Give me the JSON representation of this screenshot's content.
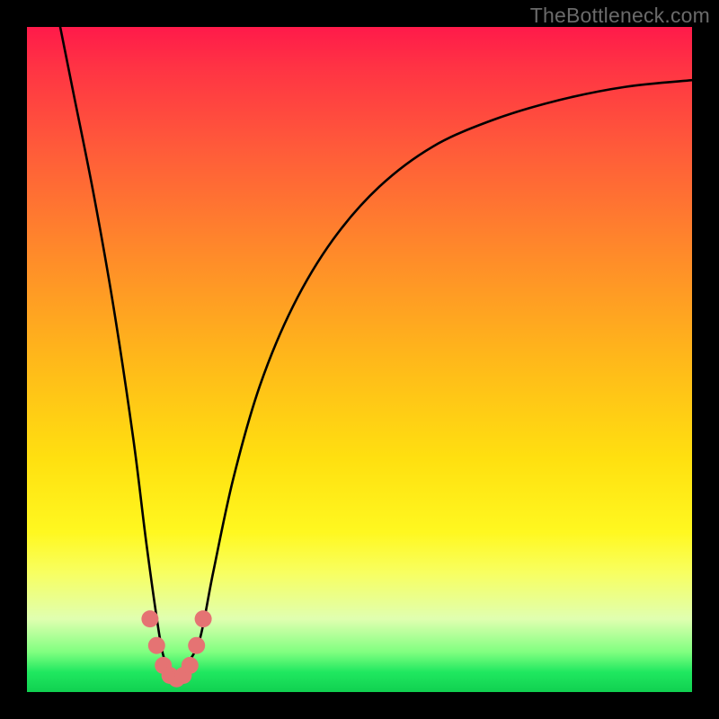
{
  "watermark": "TheBottleneck.com",
  "chart_data": {
    "type": "line",
    "title": "",
    "xlabel": "",
    "ylabel": "",
    "xlim": [
      0,
      100
    ],
    "ylim": [
      0,
      100
    ],
    "grid": false,
    "legend": false,
    "series": [
      {
        "name": "bottleneck-curve",
        "x": [
          5,
          7,
          10,
          13,
          16,
          18,
          20,
          21,
          22,
          23,
          24,
          26,
          28,
          31,
          35,
          40,
          46,
          53,
          61,
          70,
          80,
          90,
          100
        ],
        "values": [
          100,
          90,
          75,
          58,
          38,
          22,
          8,
          4,
          2,
          2,
          4,
          8,
          18,
          32,
          46,
          58,
          68,
          76,
          82,
          86,
          89,
          91,
          92
        ]
      },
      {
        "name": "highlight-dots",
        "x": [
          18.5,
          19.5,
          20.5,
          21.5,
          22.5,
          23.5,
          24.5,
          25.5,
          26.5
        ],
        "values": [
          11,
          7,
          4,
          2.5,
          2,
          2.5,
          4,
          7,
          11
        ]
      },
      {
        "name": "gradient-stops",
        "x": [
          0,
          6,
          18,
          34,
          50,
          65,
          76,
          82,
          89,
          94,
          97,
          100
        ],
        "values": [
          "#ff1a4a",
          "#ff3344",
          "#ff5a3a",
          "#ff8a2a",
          "#ffb81a",
          "#ffe010",
          "#fff820",
          "#f8ff60",
          "#e0ffb0",
          "#80ff80",
          "#20e860",
          "#10d050"
        ]
      }
    ],
    "notes": "V-shaped bottleneck curve. Both branches descend toward a trough near x≈22, y≈2. Percent values are estimated from pixel positions; no axes, ticks, or labels are rendered in the source image."
  }
}
